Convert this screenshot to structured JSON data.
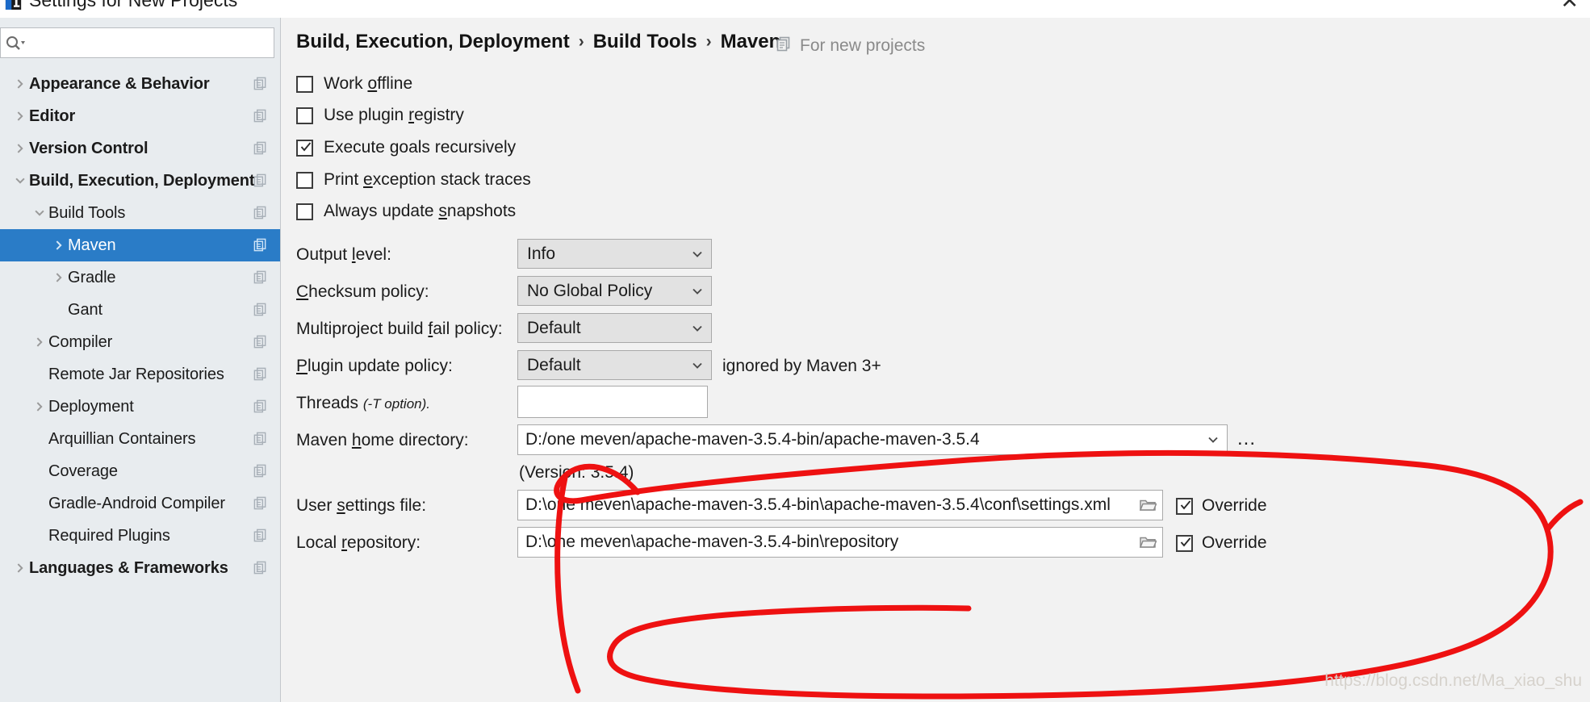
{
  "window": {
    "title": "Settings for New Projects",
    "close_label": "✕",
    "logo_icon": "intellij-logo-icon"
  },
  "sidebar": {
    "search": {
      "value": "",
      "placeholder": "",
      "icon": "search-icon"
    },
    "row_action_icon": "copy-settings-icon",
    "items": [
      {
        "label": "Appearance & Behavior",
        "depth": 0,
        "bold": true,
        "arrow": "collapsed",
        "selected": false,
        "action": true
      },
      {
        "label": "Editor",
        "depth": 0,
        "bold": true,
        "arrow": "collapsed",
        "selected": false,
        "action": true
      },
      {
        "label": "Version Control",
        "depth": 0,
        "bold": true,
        "arrow": "collapsed",
        "selected": false,
        "action": true
      },
      {
        "label": "Build, Execution, Deployment",
        "depth": 0,
        "bold": true,
        "arrow": "expanded",
        "selected": false,
        "action": true
      },
      {
        "label": "Build Tools",
        "depth": 1,
        "bold": false,
        "arrow": "expanded",
        "selected": false,
        "action": true
      },
      {
        "label": "Maven",
        "depth": 2,
        "bold": false,
        "arrow": "collapsed",
        "selected": true,
        "action": true
      },
      {
        "label": "Gradle",
        "depth": 2,
        "bold": false,
        "arrow": "collapsed",
        "selected": false,
        "action": true
      },
      {
        "label": "Gant",
        "depth": 2,
        "bold": false,
        "arrow": "none",
        "selected": false,
        "action": true
      },
      {
        "label": "Compiler",
        "depth": 1,
        "bold": false,
        "arrow": "collapsed",
        "selected": false,
        "action": true
      },
      {
        "label": "Remote Jar Repositories",
        "depth": 1,
        "bold": false,
        "arrow": "none",
        "selected": false,
        "action": true
      },
      {
        "label": "Deployment",
        "depth": 1,
        "bold": false,
        "arrow": "collapsed",
        "selected": false,
        "action": true
      },
      {
        "label": "Arquillian Containers",
        "depth": 1,
        "bold": false,
        "arrow": "none",
        "selected": false,
        "action": true
      },
      {
        "label": "Coverage",
        "depth": 1,
        "bold": false,
        "arrow": "none",
        "selected": false,
        "action": true
      },
      {
        "label": "Gradle-Android Compiler",
        "depth": 1,
        "bold": false,
        "arrow": "none",
        "selected": false,
        "action": true
      },
      {
        "label": "Required Plugins",
        "depth": 1,
        "bold": false,
        "arrow": "none",
        "selected": false,
        "action": true
      },
      {
        "label": "Languages & Frameworks",
        "depth": 0,
        "bold": true,
        "arrow": "collapsed",
        "selected": false,
        "action": true
      }
    ]
  },
  "main": {
    "breadcrumb": {
      "parts": [
        "Build, Execution, Deployment",
        "Build Tools",
        "Maven"
      ],
      "separator": "›"
    },
    "for_new_projects": {
      "label": "For new projects",
      "icon": "copy-settings-icon"
    },
    "checkboxes": [
      {
        "label_before": "Work ",
        "mnemonic": "o",
        "label_after": "ffline",
        "checked": false
      },
      {
        "label_before": "Use plugin ",
        "mnemonic": "r",
        "label_after": "egistry",
        "checked": false
      },
      {
        "label_before": "Execute ",
        "mnemonic": "g",
        "label_after": "oals recursively",
        "checked": true
      },
      {
        "label_before": "Print ",
        "mnemonic": "e",
        "label_after": "xception stack traces",
        "checked": false
      },
      {
        "label_before": "Always update ",
        "mnemonic": "s",
        "label_after": "napshots",
        "checked": false
      }
    ],
    "fields": {
      "output_level": {
        "label_before": "Output ",
        "mnemonic": "l",
        "label_after": "evel:",
        "value": "Info"
      },
      "checksum_policy": {
        "label_before": "",
        "mnemonic": "C",
        "label_after": "hecksum policy:",
        "value": "No Global Policy"
      },
      "multiproject": {
        "label_before": "Multiproject build ",
        "mnemonic": "f",
        "label_after": "ail policy:",
        "value": "Default"
      },
      "plugin_update": {
        "label_before": "",
        "mnemonic": "P",
        "label_after": "lugin update policy:",
        "value": "Default",
        "hint": "ignored by Maven 3+"
      },
      "threads": {
        "label_before": "Threads ",
        "note": "(-T option).",
        "value": ""
      },
      "maven_home": {
        "label_before": "Maven ",
        "mnemonic": "h",
        "label_after": "ome directory:",
        "value": "D:/one meven/apache-maven-3.5.4-bin/apache-maven-3.5.4",
        "browse_label": "...",
        "version_note": "(Version: 3.5.4)"
      },
      "user_settings": {
        "label_before": "User ",
        "mnemonic": "s",
        "label_after": "ettings file:",
        "value": "D:\\one meven\\apache-maven-3.5.4-bin\\apache-maven-3.5.4\\conf\\settings.xml",
        "override_label": "Override",
        "override_checked": true,
        "folder_icon": "folder-icon"
      },
      "local_repository": {
        "label_before": "Local ",
        "mnemonic": "r",
        "label_after": "epository:",
        "value": "D:\\one meven\\apache-maven-3.5.4-bin\\repository",
        "override_label": "Override",
        "override_checked": true,
        "folder_icon": "folder-icon"
      }
    }
  },
  "annotation": {
    "color": "#ee1111",
    "shape": "hand-drawn-ellipse"
  },
  "watermark": "https://blog.csdn.net/Ma_xiao_shu",
  "colors": {
    "selection": "#2a7cc7",
    "sidebar_bg": "#e8ecef",
    "panel_bg": "#f2f2f2",
    "combo_bg": "#e2e2e2",
    "annotation_red": "#ee1111"
  }
}
